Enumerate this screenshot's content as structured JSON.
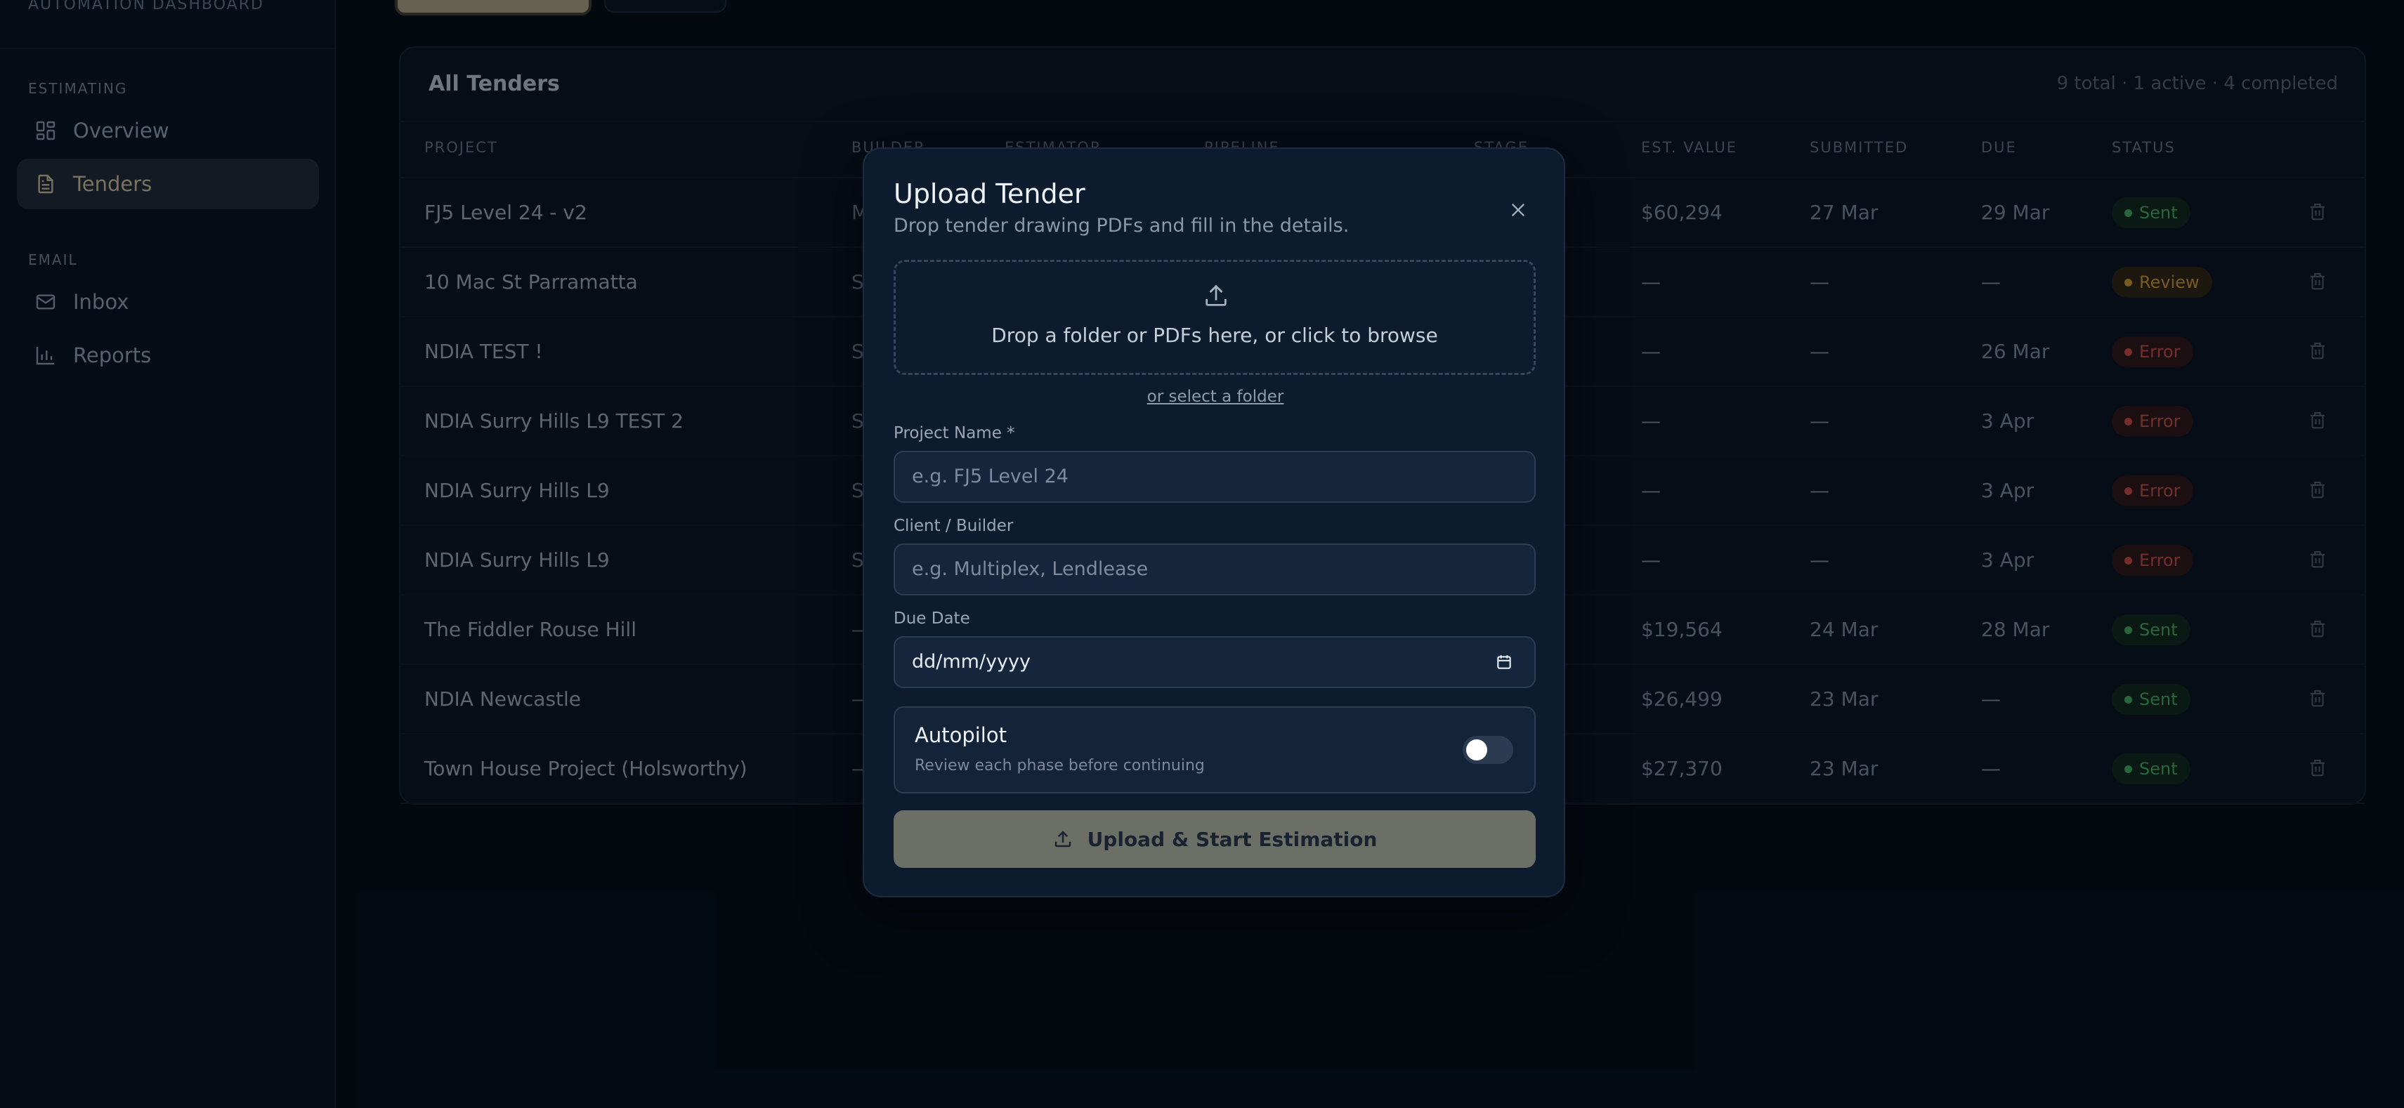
{
  "sidebar": {
    "brand": "AUTOMATION DASHBOARD",
    "sections": [
      {
        "label": "ESTIMATING",
        "items": [
          {
            "label": "Overview",
            "icon": "grid-icon",
            "active": false
          },
          {
            "label": "Tenders",
            "icon": "document-icon",
            "active": true
          }
        ]
      },
      {
        "label": "EMAIL",
        "items": [
          {
            "label": "Inbox",
            "icon": "mail-icon",
            "active": false
          },
          {
            "label": "Reports",
            "icon": "bar-chart-icon",
            "active": false
          }
        ]
      }
    ]
  },
  "table": {
    "title": "All Tenders",
    "summary": "9 total · 1 active · 4 completed",
    "columns": [
      "PROJECT",
      "BUILDER",
      "ESTIMATOR",
      "PIPELINE",
      "STAGE",
      "EST. VALUE",
      "SUBMITTED",
      "DUE",
      "STATUS"
    ],
    "rows": [
      {
        "project": "FJ5 Level 24 - v2",
        "builder": "M",
        "value": "$60,294",
        "submitted": "27 Mar",
        "due": "29 Mar",
        "status": "Sent"
      },
      {
        "project": "10 Mac St Parramatta",
        "builder": "S",
        "value": "—",
        "submitted": "—",
        "due": "—",
        "status": "Review"
      },
      {
        "project": "NDIA TEST !",
        "builder": "S",
        "value": "—",
        "submitted": "—",
        "due": "26 Mar",
        "status": "Error"
      },
      {
        "project": "NDIA Surry Hills L9 TEST 2",
        "builder": "S",
        "value": "—",
        "submitted": "—",
        "due": "3 Apr",
        "status": "Error"
      },
      {
        "project": "NDIA Surry Hills L9",
        "builder": "S",
        "value": "—",
        "submitted": "—",
        "due": "3 Apr",
        "status": "Error"
      },
      {
        "project": "NDIA Surry Hills L9",
        "builder": "S",
        "value": "—",
        "submitted": "—",
        "due": "3 Apr",
        "status": "Error"
      },
      {
        "project": "The Fiddler Rouse Hill",
        "builder": "—",
        "value": "$19,564",
        "submitted": "24 Mar",
        "due": "28 Mar",
        "status": "Sent"
      },
      {
        "project": "NDIA Newcastle",
        "builder": "—",
        "value": "$26,499",
        "submitted": "23 Mar",
        "due": "—",
        "status": "Sent"
      },
      {
        "project": "Town House Project (Holsworthy)",
        "builder": "—",
        "value": "$27,370",
        "submitted": "23 Mar",
        "due": "—",
        "status": "Sent"
      }
    ],
    "status_colors": {
      "Sent": {
        "text": "#3f9a55",
        "bg": "#0f2418"
      },
      "Review": {
        "text": "#b7862c",
        "bg": "#2a2112"
      },
      "Error": {
        "text": "#b4443f",
        "bg": "#2a1414"
      }
    }
  },
  "modal": {
    "title": "Upload Tender",
    "subtitle": "Drop tender drawing PDFs and fill in the details.",
    "drop_text": "Drop a folder or PDFs here, or click to browse",
    "folder_link": "or select a folder",
    "project_label": "Project Name *",
    "project_placeholder": "e.g. FJ5 Level 24",
    "client_label": "Client / Builder",
    "client_placeholder": "e.g. Multiplex, Lendlease",
    "due_label": "Due Date",
    "due_value": "dd/mm/yyyy",
    "autopilot_title": "Autopilot",
    "autopilot_sub": "Review each phase before continuing",
    "autopilot_on": false,
    "submit_label": "Upload & Start Estimation"
  }
}
